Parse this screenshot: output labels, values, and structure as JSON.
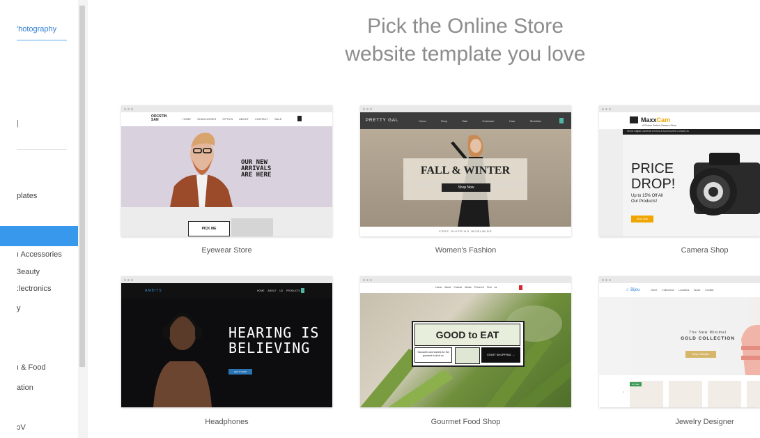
{
  "sidebar": {
    "search_value": "'hotography",
    "partial_item": "|",
    "items": [
      {
        "label": "plates"
      },
      {
        "label": ""
      },
      {
        "label": "ı Accessories"
      },
      {
        "label": "3eauty"
      },
      {
        "label": ":lectronics"
      },
      {
        "label": "y"
      },
      {
        "label": "ı & Food"
      },
      {
        "label": "ation"
      },
      {
        "label": "ɔV"
      }
    ]
  },
  "heading": {
    "line1": "Pick the Online Store",
    "line2": "website template you love"
  },
  "templates": [
    {
      "name": "Eyewear Store",
      "preview": {
        "logo_line1": "ODCSTIN",
        "logo_line2": "SAN",
        "menu": "HOME SUNGLASSES OPTICS ABOUT CONTACT SALE",
        "headline_line1": "OUR NEW",
        "headline_line2": "ARRIVALS",
        "headline_line3": "ARE HERE",
        "button": "PICK ME"
      }
    },
    {
      "name": "Women's Fashion",
      "preview": {
        "logo": "PRETTY GAL",
        "menu": "Home Shop Sale Customer Care Stockists",
        "headline": "FALL & WINTER",
        "button": "Shop Now",
        "footer": "FREE SHIPPING WORLWIDE"
      }
    },
    {
      "name": "Camera Shop",
      "preview": {
        "logo_prefix": "Maxx",
        "logo_suffix": "Cam",
        "tagline": "A Picture Perfect Camera Store",
        "menu": "Home Digital Cameras Lenses & Accessories Contact Us",
        "headline_line1": "PRICE",
        "headline_line2": "DROP!",
        "offer_line1": "Up to 15% Off All",
        "offer_line2": "Our Products!",
        "button": "Shop Now"
      }
    },
    {
      "name": "Headphones",
      "preview": {
        "logo": "AMBITS",
        "menu": "HOME ABOUT US PRODUCTS",
        "headline_line1": "HEARING IS",
        "headline_line2": "BELIEVING",
        "button": "GET IT NOW"
      }
    },
    {
      "name": "Gourmet Food Shop",
      "preview": {
        "menu": "Home About Cheese Meats Preserve Find us",
        "headline": "GOOD to EAT",
        "left_text": "Savouries and sweets for the gourmet in all of us",
        "button": "START SHOPPING →"
      }
    },
    {
      "name": "Jewelry Designer",
      "preview": {
        "logo": "Bijou",
        "menu": "Home Collections Locations About Contact",
        "subtitle": "The New Minimal",
        "headline": "GOLD COLLECTION",
        "button": "Shop Collection",
        "badge": "On Sale"
      }
    }
  ],
  "colors": {
    "accent": "#3899ec",
    "heading": "#8c8c8c",
    "camera_orange": "#f0a500"
  }
}
